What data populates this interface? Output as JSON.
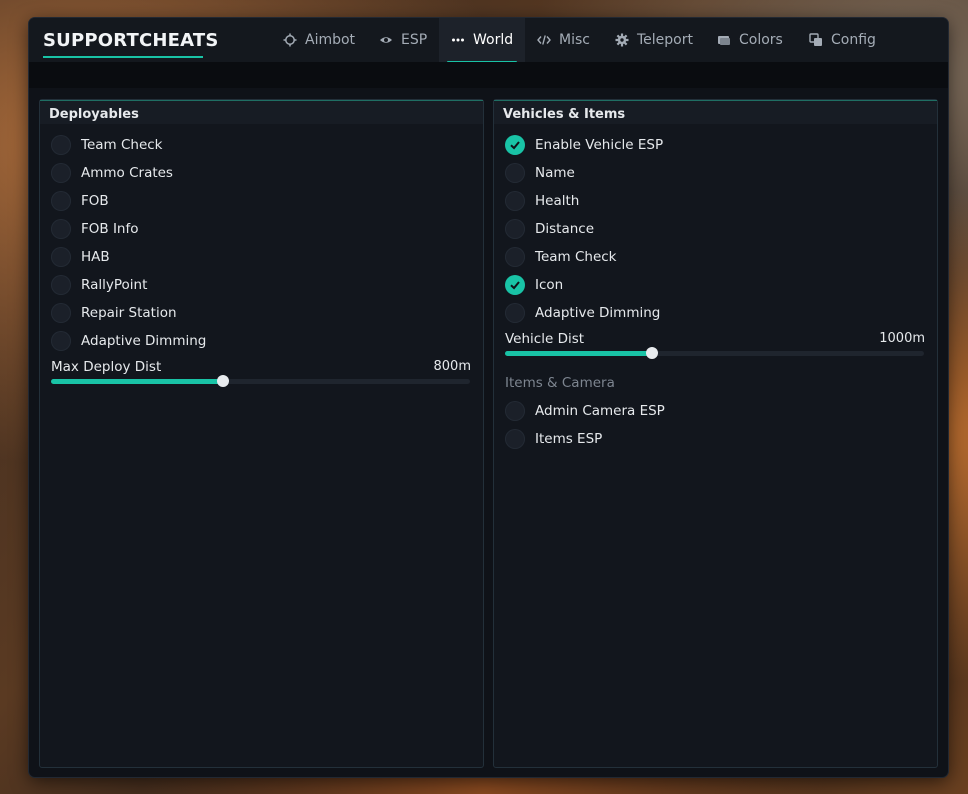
{
  "brand": "SUPPORTCHEATS",
  "accent_color": "#19c3a6",
  "tabs": [
    {
      "label": "Aimbot",
      "icon": "crosshair-icon",
      "active": false
    },
    {
      "label": "ESP",
      "icon": "eye-icon",
      "active": false
    },
    {
      "label": "World",
      "icon": "dots-icon",
      "active": true
    },
    {
      "label": "Misc",
      "icon": "code-icon",
      "active": false
    },
    {
      "label": "Teleport",
      "icon": "gear-icon",
      "active": false
    },
    {
      "label": "Colors",
      "icon": "palette-icon",
      "active": false
    },
    {
      "label": "Config",
      "icon": "copy-icon",
      "active": false
    }
  ],
  "deployables": {
    "title": "Deployables",
    "items": [
      {
        "label": "Team Check",
        "checked": false
      },
      {
        "label": "Ammo Crates",
        "checked": false
      },
      {
        "label": "FOB",
        "checked": false
      },
      {
        "label": "FOB Info",
        "checked": false
      },
      {
        "label": "HAB",
        "checked": false
      },
      {
        "label": "RallyPoint",
        "checked": false
      },
      {
        "label": "Repair Station",
        "checked": false
      },
      {
        "label": "Adaptive Dimming",
        "checked": false
      }
    ],
    "slider": {
      "label": "Max Deploy Dist",
      "value": "800m",
      "fraction": 0.41
    }
  },
  "vehicles": {
    "title": "Vehicles & Items",
    "items": [
      {
        "label": "Enable Vehicle ESP",
        "checked": true
      },
      {
        "label": "Name",
        "checked": false
      },
      {
        "label": "Health",
        "checked": false
      },
      {
        "label": "Distance",
        "checked": false
      },
      {
        "label": "Team Check",
        "checked": false
      },
      {
        "label": "Icon",
        "checked": true
      },
      {
        "label": "Adaptive Dimming",
        "checked": false
      }
    ],
    "slider": {
      "label": "Vehicle Dist",
      "value": "1000m",
      "fraction": 0.35
    },
    "section_label": "Items & Camera",
    "items2": [
      {
        "label": "Admin Camera ESP",
        "checked": false
      },
      {
        "label": "Items ESP",
        "checked": false
      }
    ]
  }
}
